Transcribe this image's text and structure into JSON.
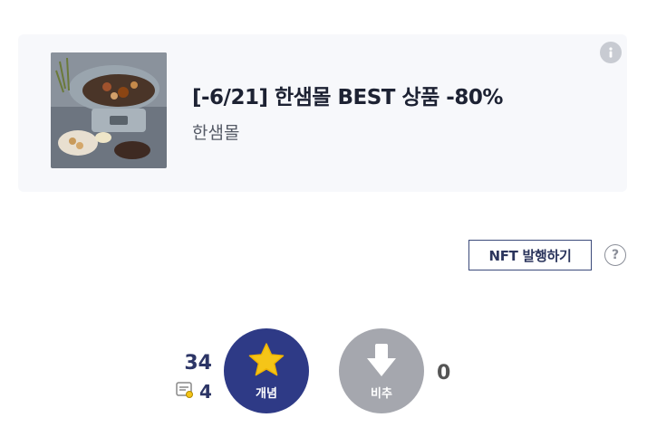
{
  "ad": {
    "title": "[-6/21] 한샘몰 BEST 상품 -80%",
    "brand": "한샘몰",
    "info_icon": "info-icon",
    "image": "electric-grill-product-photo"
  },
  "nft_button_label": "NFT 발행하기",
  "help_glyph": "?",
  "vote": {
    "up_count": "34",
    "fixed_count": "4",
    "up_label": "개념",
    "down_label": "비추",
    "down_count": "0",
    "up_color": "#2e3a86",
    "down_color": "#a5a7ae",
    "star_color": "#f5c518"
  }
}
